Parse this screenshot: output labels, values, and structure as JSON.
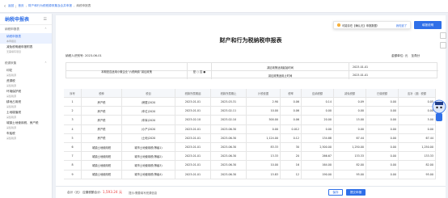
{
  "nav": {
    "back": "‹",
    "back_label": "返回",
    "crumb1": "首页",
    "crumb2": "财产和行为税税源采集及合并申报",
    "crumb3": "纳税申报表"
  },
  "sidebar": {
    "title": "纳税申报表",
    "group1": "纳税申报表",
    "group2": "税源采集",
    "items": [
      {
        "label": "纳税申报表",
        "sub": "本申报表"
      },
      {
        "label": "减免税明细申报附表",
        "sub": "无需填写项目"
      },
      {
        "label": "印花",
        "sub": "采集税源"
      },
      {
        "label": "资源税",
        "sub": "采集税源"
      },
      {
        "label": "环境保护税",
        "sub": "采集税源"
      },
      {
        "label": "耕地占用税",
        "sub": "采集税源"
      },
      {
        "label": "土地增值税",
        "sub": "采集税源"
      },
      {
        "label": "城镇土地使用税、房产税",
        "sub": "采集税源"
      },
      {
        "label": "车船税",
        "sub": "采集税源"
      }
    ]
  },
  "toast": {
    "text": "可能存在【确认无】申报数据!",
    "link": "我知道了"
  },
  "header_button": "填报说明",
  "form": {
    "title": "财产和行为税纳税申报表",
    "id_label": "纳税人识别号:",
    "id_value": "2023-06-01",
    "unit_label": "金额单位: 元",
    "unit_suffix": "至角分",
    "small_label": "本期是否适用小微企业“六税两费”减征政策",
    "small_opts": "是 ○ 否 ●",
    "reduce_start_label": "减征政策适用起始时间",
    "reduce_start_value": "2023-01-01",
    "reduce_end_label": "减征政策适用止时间",
    "reduce_end_value": "2023-01-01"
  },
  "table": {
    "headers": [
      "序号",
      "税种",
      "税目",
      "税款所属期起",
      "税款所属期止",
      "计税依据",
      "税率",
      "应纳税额",
      "减免税额",
      "已缴税额",
      "应补（退）税额"
    ],
    "rows": [
      [
        "1",
        "房产税",
        "(房屋)2020",
        "2023-01-01",
        "2023-03-31",
        "2.90",
        "0.06",
        "0.14",
        "0.09",
        "0.00",
        "0.05"
      ],
      [
        "2",
        "房产税",
        "(车位)2020",
        "2023-01-01",
        "2023-02-11",
        "10.00",
        "0.06",
        "0.00",
        "0.00",
        "0.00",
        "0.00"
      ],
      [
        "3",
        "房产税",
        "(车库)2020",
        "2023-02-10",
        "2023-02-10",
        "500.00",
        "0.06",
        "20.00",
        "15.00",
        "0.00",
        "5.00"
      ],
      [
        "4",
        "房产税",
        "(小产)2020",
        "2023-01-01",
        "2023-06-30",
        "0.00",
        "0.012",
        "0.00",
        "0.00",
        "0.00",
        "0.00"
      ],
      [
        "5",
        "房产税",
        "(土地)2020",
        "2023-01-01",
        "2023-06-30",
        "1,124.00",
        "0.12",
        "134.88",
        "67.44",
        "0.00",
        "67.44"
      ],
      [
        "6",
        "城镇土地使用税",
        "城市土地使用税(等级1)",
        "2023-01-01",
        "2023-06-30",
        "83.33",
        "30",
        "2,500.00",
        "1,250.00",
        "0.00",
        "1,250.00"
      ],
      [
        "7",
        "城镇土地使用税",
        "城市土地使用税(等级2)",
        "2023-01-01",
        "2023-06-30",
        "13.33",
        "20",
        "266.67",
        "133.33",
        "0.00",
        "133.33"
      ],
      [
        "8",
        "城镇土地使用税",
        "城市土地使用税(等级3)",
        "2023-01-01",
        "2023-06-30",
        "10.00",
        "16",
        "164.00",
        "82.00",
        "0.00",
        "82.00"
      ],
      [
        "9",
        "城镇土地使用税",
        "城市土地使用税(等级4)",
        "2023-01-01",
        "2023-06-30",
        "15.83",
        "12",
        "190.00",
        "95.00",
        "0.00",
        "95.00"
      ]
    ]
  },
  "footer": {
    "total_label": "合计（元）  应缴税额合计:",
    "total_value": "1,593.24 元",
    "note": "提示:需要填写税源信息",
    "btn_save": "保存",
    "btn_submit": "提交申报"
  },
  "accent": "#2f6fe8"
}
